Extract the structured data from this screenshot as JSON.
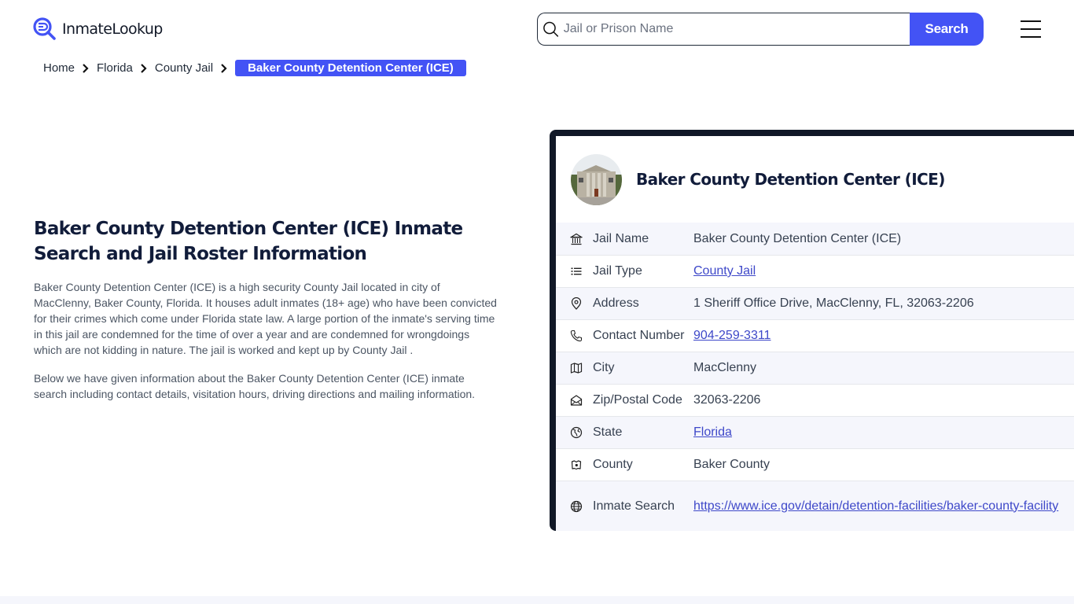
{
  "header": {
    "logo_text": "InmateLookup",
    "search": {
      "placeholder": "Jail or Prison Name",
      "value": "",
      "button_label": "Search"
    },
    "brand_color": "#4353f5"
  },
  "breadcrumb": {
    "items": [
      "Home",
      "Florida",
      "County Jail"
    ],
    "current": "Baker County Detention Center (ICE)"
  },
  "intro": {
    "title": "Baker County Detention Center (ICE) Inmate Search and Jail Roster Information",
    "paragraphs": [
      "Baker County Detention Center (ICE) is a high security County Jail located in city of MacClenny, Baker County, Florida. It houses adult inmates (18+ age) who have been convicted for their crimes which come under Florida state law. A large portion of the inmate's serving time in this jail are condemned for the time of over a year and are condemned for wrongdoings which are not kidding in nature. The jail is worked and kept up by County Jail .",
      "Below we have given information about the Baker County Detention Center (ICE) inmate search including contact details, visitation hours, driving directions and mailing information."
    ]
  },
  "card": {
    "title": "Baker County Detention Center (ICE)",
    "rows": [
      {
        "icon": "bank-icon",
        "label": "Jail Name",
        "value": "Baker County Detention Center (ICE)",
        "link": false
      },
      {
        "icon": "list-icon",
        "label": "Jail Type",
        "value": "County Jail",
        "link": true
      },
      {
        "icon": "map-pin-icon",
        "label": "Address",
        "value": "1 Sheriff Office Drive, MacClenny, FL, 32063-2206",
        "link": false
      },
      {
        "icon": "phone-icon",
        "label": "Contact Number",
        "value": "904-259-3311",
        "link": true
      },
      {
        "icon": "map-icon",
        "label": "City",
        "value": "MacClenny",
        "link": false
      },
      {
        "icon": "mail-open-icon",
        "label": "Zip/Postal Code",
        "value": "32063-2206",
        "link": false
      },
      {
        "icon": "globe-state-icon",
        "label": "State",
        "value": "Florida",
        "link": true
      },
      {
        "icon": "county-map-icon",
        "label": "County",
        "value": "Baker County",
        "link": false
      },
      {
        "icon": "globe-icon",
        "label": "Inmate Search",
        "value": "https://www.ice.gov/detain/detention-facilities/baker-county-facility",
        "link": true
      }
    ]
  }
}
